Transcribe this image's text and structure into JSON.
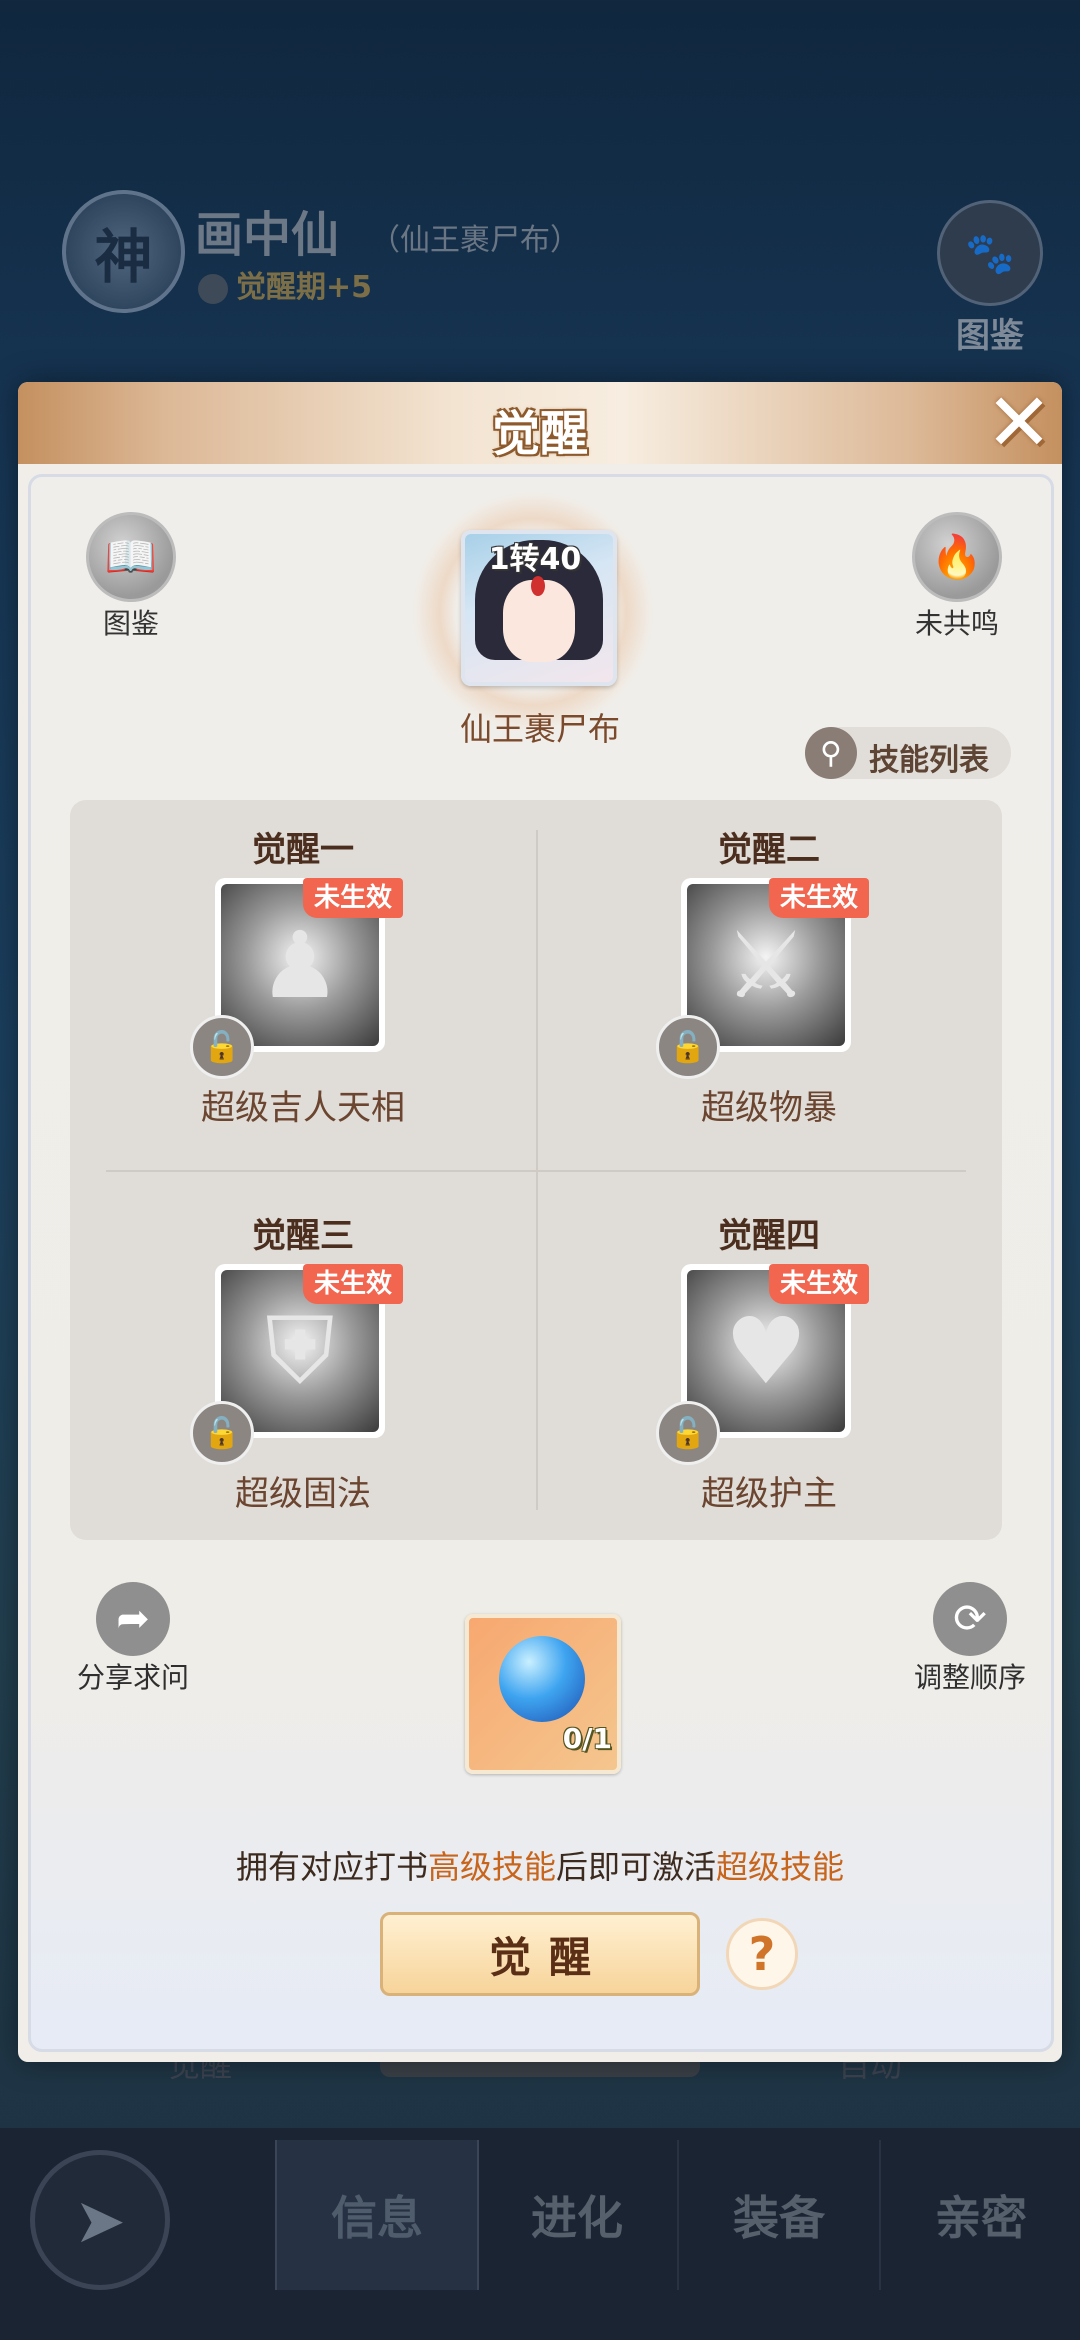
{
  "background": {
    "emblem_char": "神",
    "character_name": "画中仙",
    "character_sub": "（仙王裹尸布）",
    "stage_label": "觉醒期+5",
    "guide_label": "图鉴",
    "under_left": "觉醒",
    "under_right": "自动"
  },
  "bottom_nav": {
    "tabs": [
      {
        "label": "信息",
        "active": true
      },
      {
        "label": "进化",
        "active": false
      },
      {
        "label": "装备",
        "active": false
      },
      {
        "label": "亲密",
        "active": false
      }
    ]
  },
  "modal": {
    "title": "觉醒",
    "close_glyph": "✕",
    "guide_label": "图鉴",
    "resonance_label": "未共鸣",
    "portrait_level": "1转40",
    "character_name": "仙王裹尸布",
    "skill_list_label": "技能列表",
    "awakenings": [
      {
        "title": "觉醒一",
        "badge": "未生效",
        "name": "超级吉人天相",
        "icon": "figure-icon"
      },
      {
        "title": "觉醒二",
        "badge": "未生效",
        "name": "超级物暴",
        "icon": "axe-icon"
      },
      {
        "title": "觉醒三",
        "badge": "未生效",
        "name": "超级固法",
        "icon": "shield-flame-icon"
      },
      {
        "title": "觉醒四",
        "badge": "未生效",
        "name": "超级护主",
        "icon": "heart-hands-icon"
      }
    ],
    "share_label": "分享求问",
    "reorder_label": "调整顺序",
    "item_count": "0/1",
    "hint_parts": [
      "拥有对应打书",
      "高级技能",
      "后即可激活",
      "超级技能"
    ],
    "awaken_button": "觉醒",
    "help_glyph": "?"
  },
  "colors": {
    "badge": "#f2654f",
    "highlight": "#c8651d",
    "title_text": "#4b2e1e"
  }
}
